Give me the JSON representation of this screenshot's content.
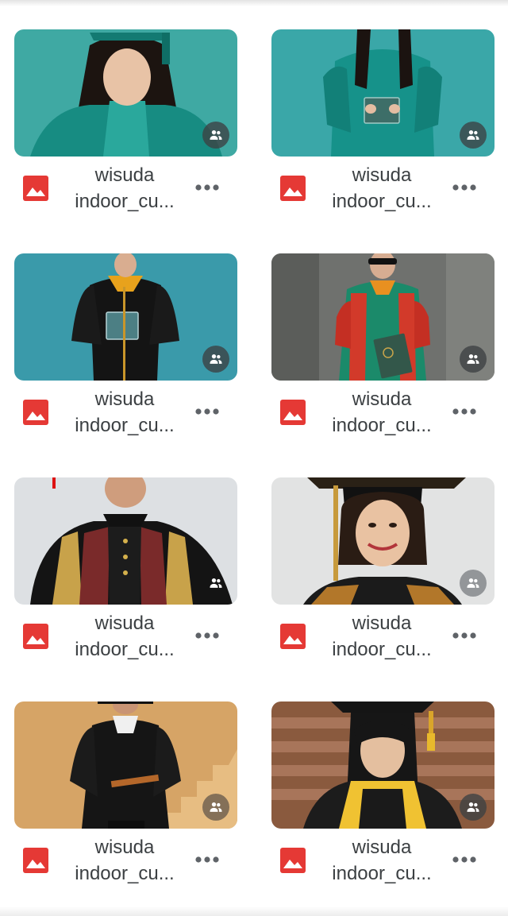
{
  "colors": {
    "file_icon": "#e53935",
    "text": "#3c4043",
    "shared_badge": "#3c4043"
  },
  "files": [
    {
      "line1": "wisuda",
      "line2": "indoor_cu...",
      "file_icon": "image-file-icon",
      "badge_icon": "shared-people-icon",
      "menu_icon": "more-horizontal-icon"
    },
    {
      "line1": "wisuda",
      "line2": "indoor_cu...",
      "file_icon": "image-file-icon",
      "badge_icon": "shared-people-icon",
      "menu_icon": "more-horizontal-icon"
    },
    {
      "line1": "wisuda",
      "line2": "indoor_cu...",
      "file_icon": "image-file-icon",
      "badge_icon": "shared-people-icon",
      "menu_icon": "more-horizontal-icon"
    },
    {
      "line1": "wisuda",
      "line2": "indoor_cu...",
      "file_icon": "image-file-icon",
      "badge_icon": "shared-people-icon",
      "menu_icon": "more-horizontal-icon"
    },
    {
      "line1": "wisuda",
      "line2": "indoor_cu...",
      "file_icon": "image-file-icon",
      "badge_icon": "shared-people-icon",
      "menu_icon": "more-horizontal-icon"
    },
    {
      "line1": "wisuda",
      "line2": "indoor_cu...",
      "file_icon": "image-file-icon",
      "badge_icon": "shared-people-icon",
      "menu_icon": "more-horizontal-icon"
    },
    {
      "line1": "wisuda",
      "line2": "indoor_cu...",
      "file_icon": "image-file-icon",
      "badge_icon": "shared-people-icon",
      "menu_icon": "more-horizontal-icon"
    },
    {
      "line1": "wisuda",
      "line2": "indoor_cu...",
      "file_icon": "image-file-icon",
      "badge_icon": "shared-people-icon",
      "menu_icon": "more-horizontal-icon"
    }
  ]
}
